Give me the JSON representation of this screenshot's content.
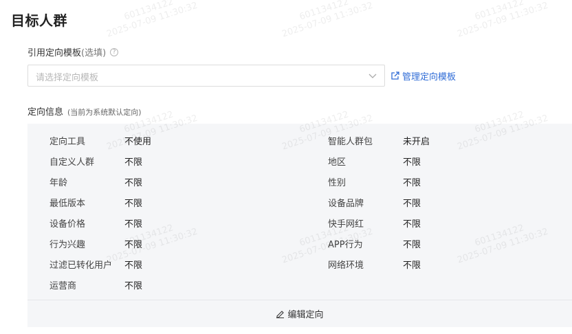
{
  "header": {
    "title": "目标人群"
  },
  "template": {
    "label": "引用定向模板",
    "optional_hint": "(选填)",
    "help_icon": "question-circle-icon",
    "select": {
      "placeholder": "请选择定向模板",
      "icon": "chevron-down-icon"
    },
    "manage_link": {
      "label": "管理定向模板",
      "icon": "external-link-icon",
      "color": "#2e6bd6"
    }
  },
  "targeting_info": {
    "label": "定向信息",
    "note": "(当前为系统默认定向)",
    "rows": [
      {
        "left": {
          "key": "定向工具",
          "value": "不使用"
        },
        "right": {
          "key": "智能人群包",
          "value": "未开启"
        }
      },
      {
        "left": {
          "key": "自定义人群",
          "value": "不限"
        },
        "right": {
          "key": "地区",
          "value": "不限"
        }
      },
      {
        "left": {
          "key": "年龄",
          "value": "不限"
        },
        "right": {
          "key": "性别",
          "value": "不限"
        }
      },
      {
        "left": {
          "key": "最低版本",
          "value": "不限"
        },
        "right": {
          "key": "设备品牌",
          "value": "不限"
        }
      },
      {
        "left": {
          "key": "设备价格",
          "value": "不限"
        },
        "right": {
          "key": "快手网红",
          "value": "不限"
        }
      },
      {
        "left": {
          "key": "行为兴趣",
          "value": "不限"
        },
        "right": {
          "key": "APP行为",
          "value": "不限"
        }
      },
      {
        "left": {
          "key": "过滤已转化用户",
          "value": "不限"
        },
        "right": {
          "key": "网络环境",
          "value": "不限"
        }
      },
      {
        "left": {
          "key": "运营商",
          "value": "不限"
        }
      }
    ],
    "edit_button": {
      "label": "编辑定向",
      "icon": "pencil-icon"
    }
  },
  "watermark": {
    "id": "601134122",
    "timestamp": "2025-07-09 11:30:32"
  },
  "colors": {
    "panel_bg": "#f5f6f8",
    "link": "#2e6bd6"
  }
}
